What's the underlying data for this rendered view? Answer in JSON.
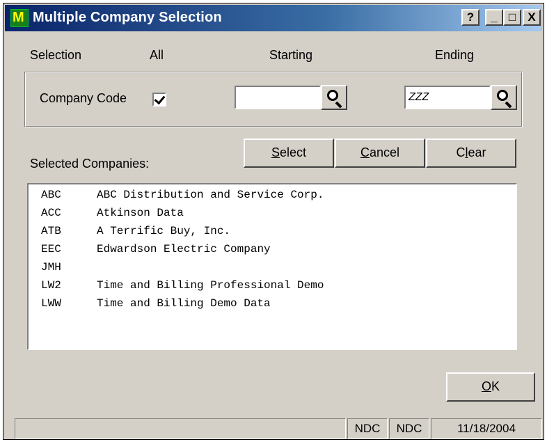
{
  "window": {
    "title": "Multiple Company Selection",
    "help_label": "?",
    "min_label": "_",
    "max_label": "□",
    "close_label": "X"
  },
  "headers": {
    "selection": "Selection",
    "all": "All",
    "starting": "Starting",
    "ending": "Ending"
  },
  "row": {
    "label": "Company Code",
    "all_checked": true,
    "starting_value": "",
    "ending_value": "ZZZ"
  },
  "selected_label": "Selected Companies:",
  "buttons": {
    "select": {
      "accel": "S",
      "rest": "elect"
    },
    "cancel": {
      "accel": "C",
      "rest": "ancel"
    },
    "clear": {
      "pre": "C",
      "accel": "l",
      "rest": "ear"
    },
    "ok": {
      "accel": "O",
      "rest": "K"
    }
  },
  "companies": [
    {
      "code": "ABC",
      "name": "ABC Distribution and Service Corp."
    },
    {
      "code": "ACC",
      "name": "Atkinson Data"
    },
    {
      "code": "ATB",
      "name": "A Terrific Buy, Inc."
    },
    {
      "code": "EEC",
      "name": "Edwardson Electric Company"
    },
    {
      "code": "JMH",
      "name": ""
    },
    {
      "code": "LW2",
      "name": "Time and Billing Professional Demo"
    },
    {
      "code": "LWW",
      "name": "Time and Billing Demo Data"
    }
  ],
  "status": {
    "pane1": "",
    "company1": "NDC",
    "company2": "NDC",
    "date": "11/18/2004"
  }
}
